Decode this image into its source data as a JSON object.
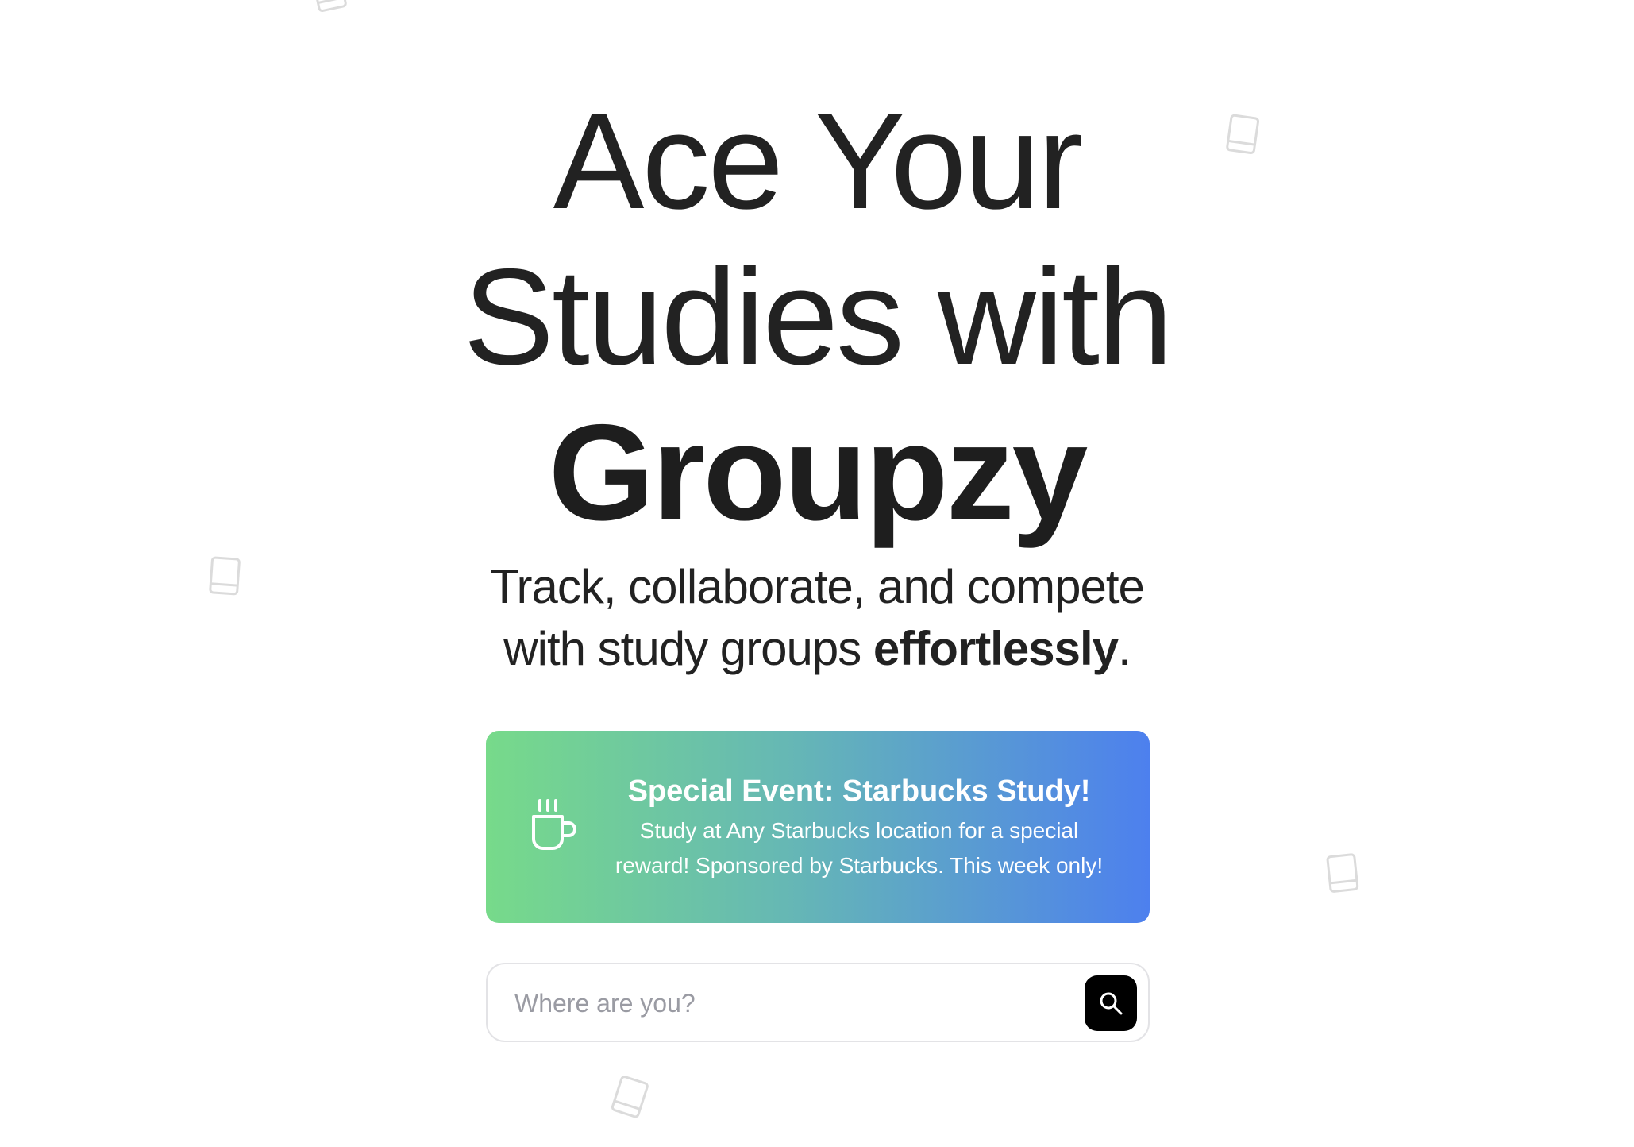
{
  "hero": {
    "line1": "Ace Your",
    "line2": "Studies with",
    "brand": "Groupzy",
    "tagline_part1": "Track, collaborate, and compete",
    "tagline_part2": "with study groups ",
    "tagline_emphasis": "effortlessly",
    "tagline_end": "."
  },
  "event": {
    "icon": "coffee-cup-icon",
    "title": "Special Event: Starbucks Study!",
    "description_line1": "Study at Any Starbucks location for a special",
    "description_line2": "reward! Sponsored by Starbucks. This week only!",
    "gradient_start": "#77da8a",
    "gradient_end": "#4d80ee"
  },
  "search": {
    "placeholder": "Where are you?",
    "value": "",
    "button_icon": "search-icon"
  },
  "decorations": {
    "icon": "book-icon"
  },
  "colors": {
    "background": "#ffffff",
    "text": "#222222",
    "search_button": "#000000"
  }
}
